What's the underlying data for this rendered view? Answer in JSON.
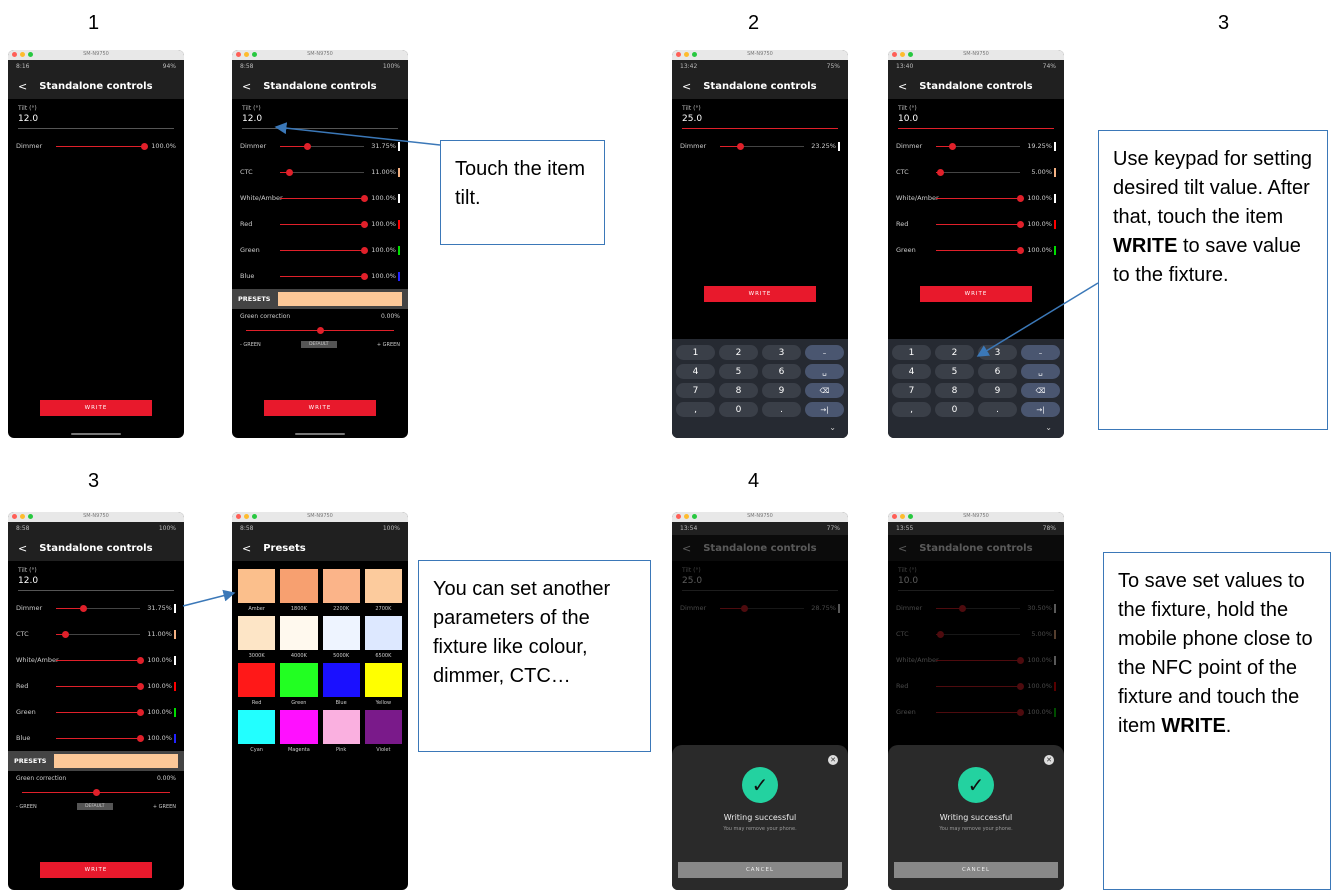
{
  "steps": {
    "n1": "1",
    "n2": "2",
    "n3a": "3",
    "n3b": "3",
    "n4": "4"
  },
  "common": {
    "window_title": "SM-N9750",
    "screen_title": "Standalone controls",
    "back": "<",
    "tilt_label": "Tilt (°)",
    "presets_label": "PRESETS",
    "green_correction": "Green correction",
    "gc_value": "0.00%",
    "minus_green": "- GREEN",
    "plus_green": "+ GREEN",
    "default": "DEFAULT",
    "write": "WRITE",
    "writing_successful": "Writing successful",
    "remove_phone": "You may remove your phone.",
    "cancel": "CANCEL"
  },
  "screens": {
    "s1": {
      "time": "8:16",
      "status": "94%",
      "tilt": "12.0",
      "rows": [
        {
          "label": "Dimmer",
          "value": "100.0%",
          "level": 100
        }
      ]
    },
    "s2": {
      "time": "8:58",
      "status": "100%",
      "tilt": "12.0",
      "rows": [
        {
          "label": "Dimmer",
          "value": "31.75%",
          "level": 31.75,
          "swatch": "#ffffff"
        },
        {
          "label": "CTC",
          "value": "11.00%",
          "level": 11,
          "swatch": "#f4b183"
        },
        {
          "label": "White/Amber",
          "value": "100.0%",
          "level": 100,
          "swatch": "#ffffff"
        },
        {
          "label": "Red",
          "value": "100.0%",
          "level": 100,
          "swatch": "#ff0000"
        },
        {
          "label": "Green",
          "value": "100.0%",
          "level": 100,
          "swatch": "#00dd00"
        },
        {
          "label": "Blue",
          "value": "100.0%",
          "level": 100,
          "swatch": "#2222ff"
        }
      ],
      "preset_color": "#fcc898"
    },
    "s3": {
      "time": "13:42",
      "status": "75%",
      "tilt": "25.0",
      "rows": [
        {
          "label": "Dimmer",
          "value": "23.25%",
          "level": 23.25,
          "swatch": "#ffffff"
        }
      ]
    },
    "s4": {
      "time": "13:40",
      "status": "74%",
      "tilt": "10.0",
      "rows": [
        {
          "label": "Dimmer",
          "value": "19.25%",
          "level": 19.25,
          "swatch": "#ffffff"
        },
        {
          "label": "CTC",
          "value": "5.00%",
          "level": 5,
          "swatch": "#f4b183"
        },
        {
          "label": "White/Amber",
          "value": "100.0%",
          "level": 100,
          "swatch": "#ffffff"
        },
        {
          "label": "Red",
          "value": "100.0%",
          "level": 100,
          "swatch": "#ff0000"
        },
        {
          "label": "Green",
          "value": "100.0%",
          "level": 100,
          "swatch": "#00dd00"
        }
      ]
    },
    "s5": {
      "time": "8:58",
      "status": "100%",
      "tilt": "12.0",
      "rows": [
        {
          "label": "Dimmer",
          "value": "31.75%",
          "level": 31.75,
          "swatch": "#ffffff"
        },
        {
          "label": "CTC",
          "value": "11.00%",
          "level": 11,
          "swatch": "#f4b183"
        },
        {
          "label": "White/Amber",
          "value": "100.0%",
          "level": 100,
          "swatch": "#ffffff"
        },
        {
          "label": "Red",
          "value": "100.0%",
          "level": 100,
          "swatch": "#ff0000"
        },
        {
          "label": "Green",
          "value": "100.0%",
          "level": 100,
          "swatch": "#00dd00"
        },
        {
          "label": "Blue",
          "value": "100.0%",
          "level": 100,
          "swatch": "#2222ff"
        }
      ],
      "preset_color": "#fcc898"
    },
    "s6": {
      "time": "8:58",
      "status": "100%",
      "title": "Presets",
      "presets": [
        {
          "label": "Amber",
          "color": "#fbbf8c"
        },
        {
          "label": "1800K",
          "color": "#f7a070"
        },
        {
          "label": "2200K",
          "color": "#fbb489"
        },
        {
          "label": "2700K",
          "color": "#fccb9d"
        },
        {
          "label": "3000K",
          "color": "#fde5c6"
        },
        {
          "label": "4000K",
          "color": "#fff9ee"
        },
        {
          "label": "5000K",
          "color": "#eef4ff"
        },
        {
          "label": "6500K",
          "color": "#dde8ff"
        },
        {
          "label": "Red",
          "color": "#ff1818"
        },
        {
          "label": "Green",
          "color": "#22ff22"
        },
        {
          "label": "Blue",
          "color": "#1a10ff"
        },
        {
          "label": "Yellow",
          "color": "#ffff00"
        },
        {
          "label": "Cyan",
          "color": "#22ffff"
        },
        {
          "label": "Magenta",
          "color": "#ff10ff"
        },
        {
          "label": "Pink",
          "color": "#fab0e0"
        },
        {
          "label": "Violet",
          "color": "#7a1a8a"
        }
      ]
    },
    "s7": {
      "time": "13:54",
      "status": "77%",
      "tilt": "25.0",
      "rows": [
        {
          "label": "Dimmer",
          "value": "28.75%",
          "level": 28.75,
          "swatch": "#ffffff"
        }
      ]
    },
    "s8": {
      "time": "13:55",
      "status": "78%",
      "tilt": "10.0",
      "rows": [
        {
          "label": "Dimmer",
          "value": "30.50%",
          "level": 30.5,
          "swatch": "#ffffff"
        },
        {
          "label": "CTC",
          "value": "5.00%",
          "level": 5,
          "swatch": "#f4b183"
        },
        {
          "label": "White/Amber",
          "value": "100.0%",
          "level": 100,
          "swatch": "#ffffff"
        },
        {
          "label": "Red",
          "value": "100.0%",
          "level": 100,
          "swatch": "#ff0000"
        },
        {
          "label": "Green",
          "value": "100.0%",
          "level": 100,
          "swatch": "#00dd00"
        }
      ]
    }
  },
  "keypad": [
    [
      "1",
      "2",
      "3",
      "–"
    ],
    [
      "4",
      "5",
      "6",
      "␣"
    ],
    [
      "7",
      "8",
      "9",
      "⌫"
    ],
    [
      ",",
      "0",
      ".",
      "→|"
    ]
  ],
  "callouts": {
    "c1": "Touch the item tilt.",
    "c2": "Use keypad for setting desired tilt value. After that, touch the item WRITE to save value to the fixture.",
    "c3": "You can set another parameters of the fixture like colour, dimmer, CTC…",
    "c4": "To save set values to the fixture, hold the mobile phone close to the NFC point of the fixture and touch the item WRITE."
  },
  "colors": {
    "accent": "#e0202a",
    "callout_border": "#3b78b8",
    "success": "#23d2a0"
  }
}
